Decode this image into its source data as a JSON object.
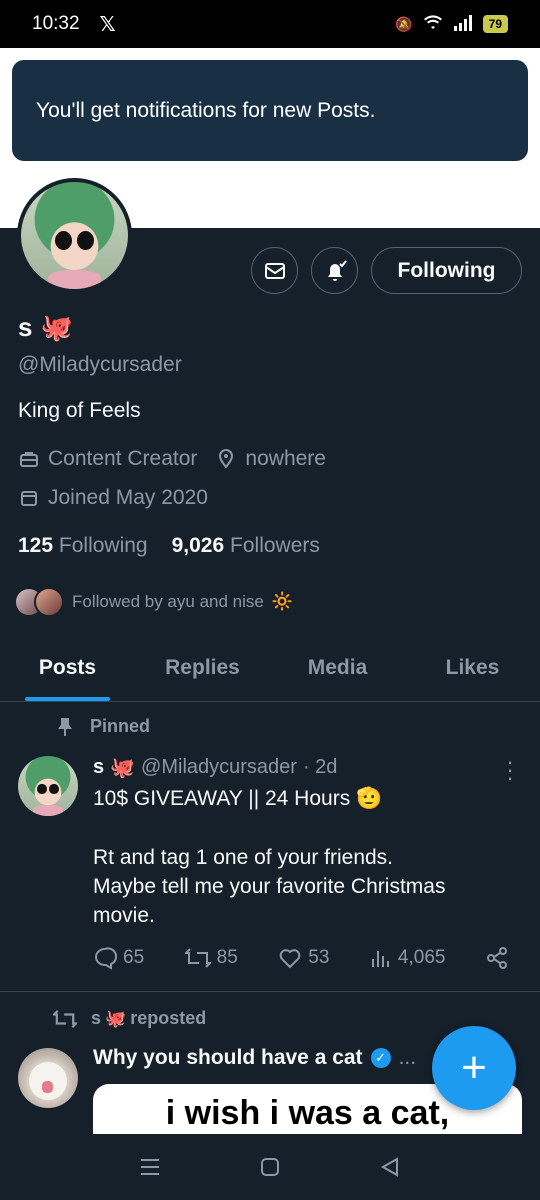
{
  "statusbar": {
    "time": "10:32",
    "app_icon": "x-logo",
    "battery": "79"
  },
  "toast": {
    "text": "You'll get notifications for new Posts."
  },
  "profile": {
    "name": "s",
    "name_emoji": "octopus-emoji",
    "handle": "@Miladycursader",
    "bio": "King of Feels",
    "category": "Content Creator",
    "location": "nowhere",
    "joined": "Joined May 2020",
    "following_count": "125",
    "following_label": "Following",
    "followers_count": "9,026",
    "followers_label": "Followers",
    "followed_by": "Followed by ayu and nise"
  },
  "actions": {
    "follow_label": "Following",
    "message_icon": "mail-icon",
    "notify_icon": "bell-check-icon"
  },
  "tabs": [
    {
      "label": "Posts",
      "active": true
    },
    {
      "label": "Replies",
      "active": false
    },
    {
      "label": "Media",
      "active": false
    },
    {
      "label": "Likes",
      "active": false
    }
  ],
  "pinned_post": {
    "pinned_label": "Pinned",
    "author": "s",
    "handle": "@Miladycursader",
    "time": "· 2d",
    "line1": "10$ GIVEAWAY || 24 Hours",
    "line2": "Rt and tag 1 one of your friends.",
    "line3": "Maybe tell me your favorite Christmas",
    "line4": "movie.",
    "replies": "65",
    "reposts": "85",
    "likes": "53",
    "views": "4,065"
  },
  "repost": {
    "reposted_label": "reposted",
    "reposter": "s",
    "title": "Why you should have a cat",
    "ellipsis": "...",
    "card_text": "i wish i was a cat,"
  },
  "colors": {
    "background": "#15202b",
    "accent": "#1d9bf0",
    "muted": "#8b98a5",
    "toast": "#193044"
  }
}
